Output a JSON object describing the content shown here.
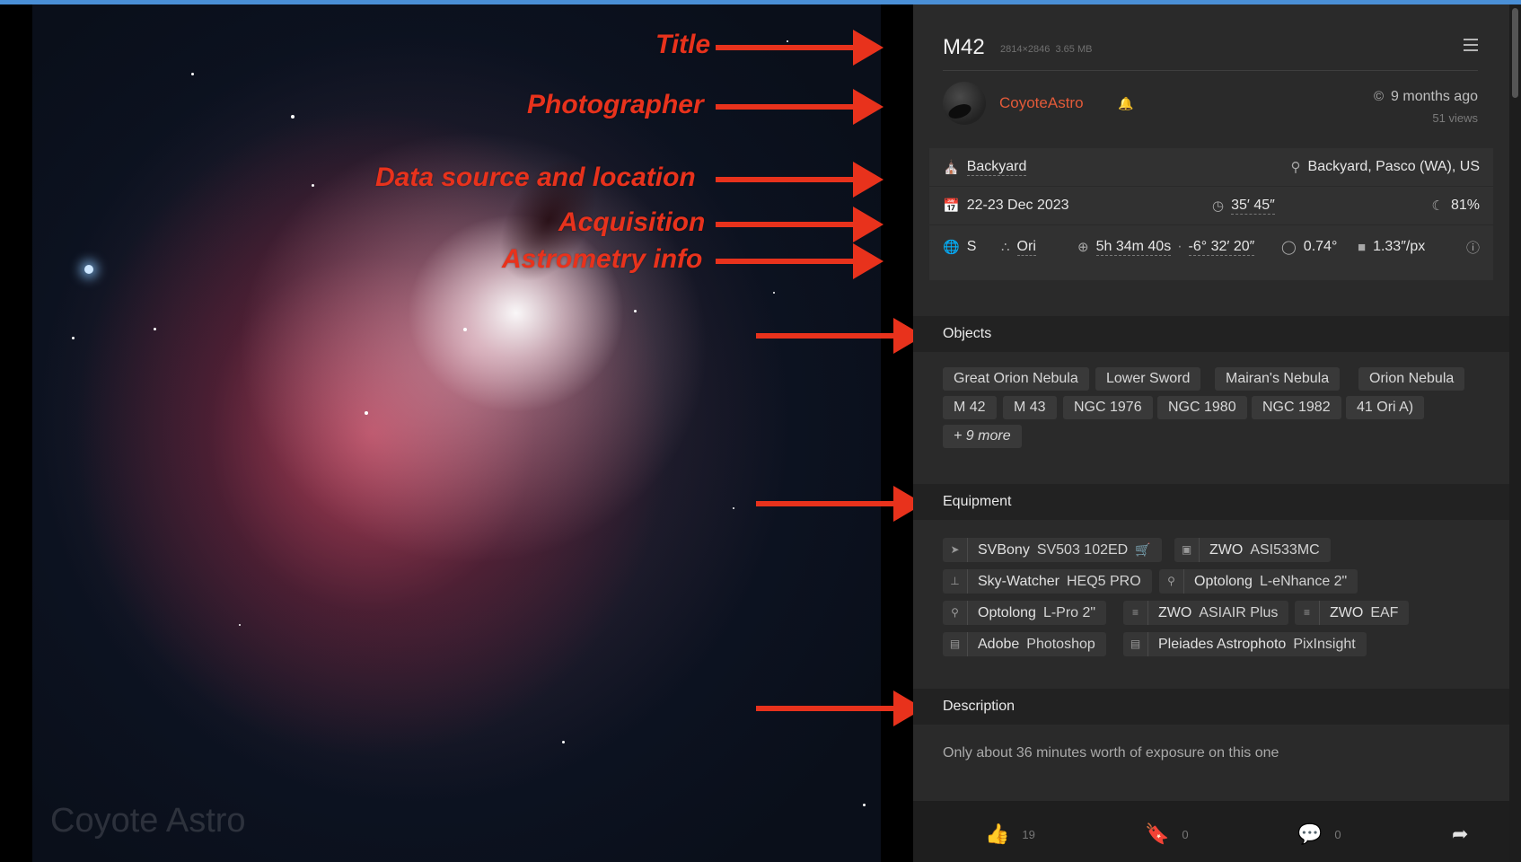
{
  "annotations": {
    "title": "Title",
    "photographer": "Photographer",
    "data_source": "Data source and location",
    "acquisition": "Acquisition",
    "astrometry": "Astrometry info"
  },
  "image": {
    "watermark": "Coyote Astro"
  },
  "header": {
    "title": "M42",
    "dimensions": "2814×2846",
    "size": "3.65 MB"
  },
  "user": {
    "name": "CoyoteAstro",
    "time_ago": "9 months ago",
    "views": "51 views"
  },
  "meta": {
    "source": "Backyard",
    "location": "Backyard, Pasco (WA), US",
    "date": "22-23 Dec 2023",
    "integration": "35′ 45″",
    "moon": "81%",
    "hemisphere": "S",
    "constellation": "Ori",
    "ra": "5h 34m 40s",
    "dec": "-6° 32′ 20″",
    "fov": "0.74°",
    "pixscale": "1.33″/px"
  },
  "sections": {
    "objects": "Objects",
    "equipment": "Equipment",
    "description": "Description"
  },
  "objects": [
    "Great Orion Nebula",
    "Lower Sword",
    "Mairan's Nebula",
    "Orion Nebula",
    "M 42",
    "M 43",
    "NGC 1976",
    "NGC 1980",
    "NGC 1982",
    "41 Ori A)",
    "+ 9 more"
  ],
  "equipment": [
    {
      "brand": "SVBony",
      "model": "SV503 102ED",
      "icon": "telescope-icon"
    },
    {
      "brand": "ZWO",
      "model": "ASI533MC",
      "icon": "camera-icon"
    },
    {
      "brand": "Sky-Watcher",
      "model": "HEQ5 PRO",
      "icon": "mount-icon"
    },
    {
      "brand": "Optolong",
      "model": "L-eNhance 2\"",
      "icon": "filter-icon"
    },
    {
      "brand": "Optolong",
      "model": "L-Pro 2\"",
      "icon": "filter-icon"
    },
    {
      "brand": "ZWO",
      "model": "ASIAIR Plus",
      "icon": "accessory-icon"
    },
    {
      "brand": "ZWO",
      "model": "EAF",
      "icon": "accessory-icon"
    },
    {
      "brand": "Adobe",
      "model": "Photoshop",
      "icon": "software-icon"
    },
    {
      "brand": "Pleiades Astrophoto",
      "model": "PixInsight",
      "icon": "software-icon"
    }
  ],
  "description": "Only about 36 minutes worth of exposure on this one",
  "footer": {
    "likes": "19",
    "bookmarks": "0",
    "comments": "0"
  },
  "colors": {
    "accent": "#e35a39",
    "annotation": "#e8321c",
    "panel_bg": "#2a2a2a"
  }
}
